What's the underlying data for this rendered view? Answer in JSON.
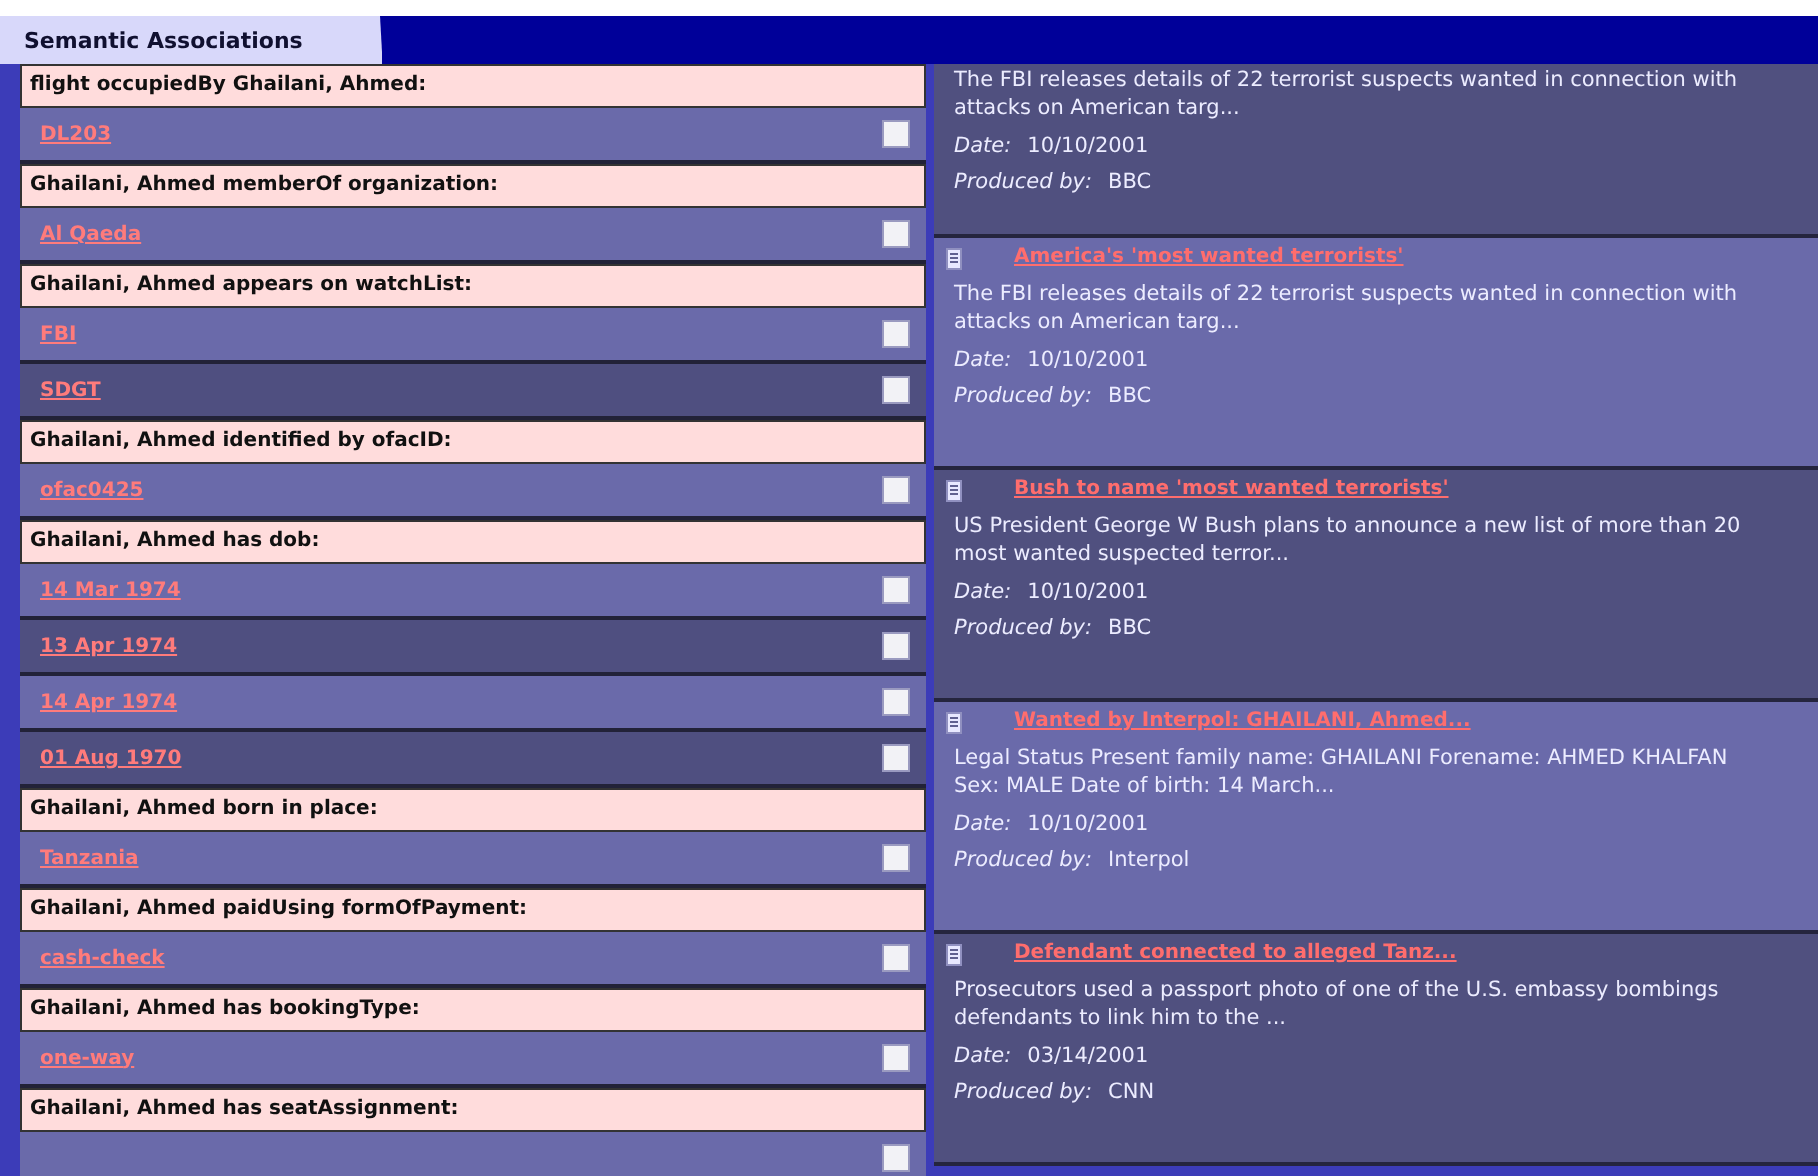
{
  "tab": {
    "label": "Semantic Associations",
    "selected": true
  },
  "associations": [
    {
      "header": "flight occupiedBy Ghailani, Ahmed:",
      "values": [
        {
          "text": "DL203",
          "checked": false
        }
      ]
    },
    {
      "header": "Ghailani, Ahmed memberOf organization:",
      "values": [
        {
          "text": "Al Qaeda",
          "checked": false
        }
      ]
    },
    {
      "header": "Ghailani, Ahmed appears on watchList:",
      "values": [
        {
          "text": "FBI",
          "checked": false
        },
        {
          "text": "SDGT",
          "checked": false
        }
      ]
    },
    {
      "header": "Ghailani, Ahmed identified by ofacID:",
      "values": [
        {
          "text": "ofac0425",
          "checked": false
        }
      ]
    },
    {
      "header": "Ghailani, Ahmed has dob:",
      "values": [
        {
          "text": "14 Mar 1974",
          "checked": false
        },
        {
          "text": "13 Apr 1974",
          "checked": false
        },
        {
          "text": "14 Apr 1974",
          "checked": false
        },
        {
          "text": "01 Aug 1970",
          "checked": false
        }
      ]
    },
    {
      "header": "Ghailani, Ahmed born in place:",
      "values": [
        {
          "text": "Tanzania",
          "checked": false
        }
      ]
    },
    {
      "header": "Ghailani, Ahmed paidUsing formOfPayment:",
      "values": [
        {
          "text": "cash-check",
          "checked": false
        }
      ]
    },
    {
      "header": "Ghailani, Ahmed has bookingType:",
      "values": [
        {
          "text": "one-way",
          "checked": false
        }
      ]
    },
    {
      "header": "Ghailani, Ahmed has seatAssignment:",
      "values": [
        {
          "checked": false
        }
      ]
    }
  ],
  "articles": [
    {
      "snippet": "The FBI releases details of 22 terrorist suspects wanted in connection with attacks on American targ...",
      "date_label": "Date:",
      "date": "10/10/2001",
      "producer_label": "Produced by:",
      "producer": "BBC"
    },
    {
      "title": "America's 'most wanted terrorists'",
      "snippet": "The FBI releases details of 22 terrorist suspects wanted in connection with attacks on American targ...",
      "date_label": "Date:",
      "date": "10/10/2001",
      "producer_label": "Produced by:",
      "producer": "BBC"
    },
    {
      "title": "Bush to name 'most wanted terrorists'",
      "snippet": "US President George W Bush plans to announce a new list of more than 20 most wanted suspected terror...",
      "date_label": "Date:",
      "date": "10/10/2001",
      "producer_label": "Produced by:",
      "producer": "BBC"
    },
    {
      "title": "Wanted by Interpol: GHAILANI, Ahmed...",
      "snippet": "Legal Status Present family name: GHAILANI Forename: AHMED KHALFAN Sex: MALE Date of birth: 14 March...",
      "date_label": "Date:",
      "date": "10/10/2001",
      "producer_label": "Produced by:",
      "producer": "Interpol"
    },
    {
      "title": "Defendant connected to alleged Tanz...",
      "snippet": "Prosecutors used a passport photo of one of the U.S. embassy bombings defendants to link him to the ...",
      "date_label": "Date:",
      "date": "03/14/2001",
      "producer_label": "Produced by:",
      "producer": "CNN"
    }
  ]
}
